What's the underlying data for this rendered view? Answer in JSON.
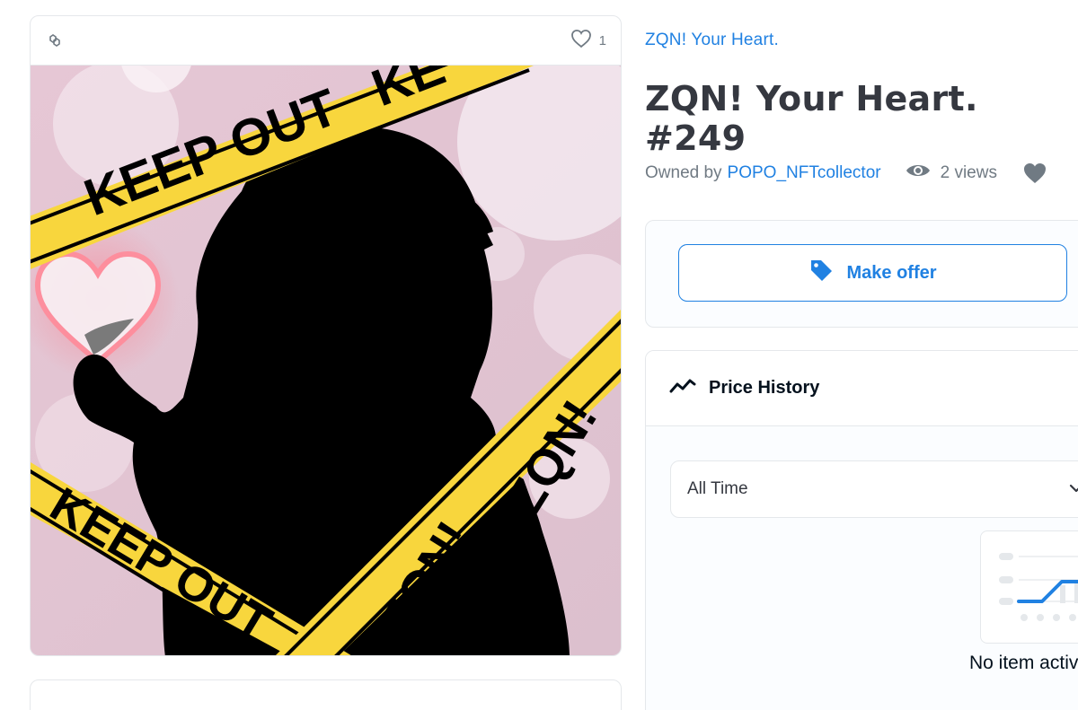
{
  "media": {
    "favorites_count": "1",
    "icons": {
      "chain": "polygon-chain-icon",
      "favorite": "heart-outline-icon"
    },
    "artwork": {
      "tape_words": [
        "KEEP OUT",
        "KE",
        "KEEP OUT",
        "ZQN!",
        "ZQN!",
        "ZQ",
        "Z",
        "!",
        "!"
      ]
    }
  },
  "item": {
    "collection": "ZQN! Your Heart.",
    "title": "ZQN! Your Heart. #249",
    "owned_by_label": "Owned by",
    "owner": "POPO_NFTcollector",
    "views": "2 views"
  },
  "offer": {
    "button_label": "Make offer",
    "icon": "tag-icon"
  },
  "price_history": {
    "heading": "Price History",
    "icon": "trend-line-icon",
    "filter_value": "All Time",
    "empty_text": "No item activity yet"
  },
  "colors": {
    "accent": "#2081e2",
    "text": "#353840",
    "muted": "#707a83",
    "tape": "#f5d33f",
    "art_bg": "#e7cbd8"
  }
}
